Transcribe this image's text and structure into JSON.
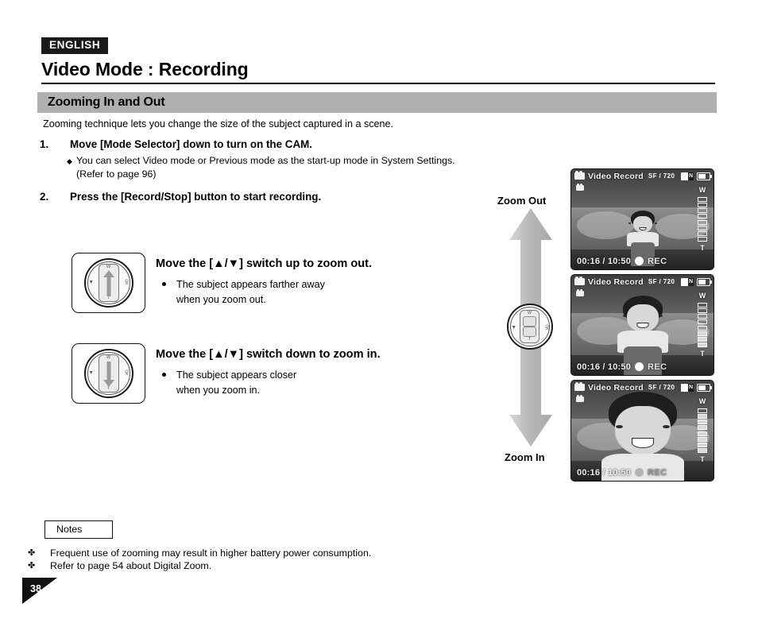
{
  "header": {
    "language_badge": "ENGLISH",
    "title": "Video Mode : Recording"
  },
  "section": {
    "title": "Zooming In and Out",
    "intro": "Zooming technique lets you change the size of the subject captured in a scene."
  },
  "steps": [
    {
      "number": "1.",
      "text": "Move [Mode Selector] down to turn on the CAM.",
      "sub_bullets": [
        {
          "marker": "◆",
          "line1": "You can select Video mode or Previous mode as the start-up mode in System Settings.",
          "line2": "(Refer to page 96)"
        }
      ]
    },
    {
      "number": "2.",
      "text": "Press the [Record/Stop] button to start recording."
    }
  ],
  "zoom_actions": [
    {
      "heading": "Move the [▲/▼] switch up to zoom out.",
      "desc_line1": "The subject appears farther away",
      "desc_line2": "when you zoom out.",
      "dial_direction": "up",
      "dial_top_label": "W",
      "dial_bottom_label": "T",
      "dial_left_label": "◀",
      "dial_right_label": "OK"
    },
    {
      "heading": "Move the [▲/▼] switch down to zoom in.",
      "desc_line1": "The subject appears closer",
      "desc_line2": "when you zoom in.",
      "dial_direction": "down",
      "dial_top_label": "W",
      "dial_bottom_label": "T",
      "dial_left_label": "◀",
      "dial_right_label": "OK"
    }
  ],
  "arrow_column": {
    "top_label": "Zoom Out",
    "bottom_label": "Zoom In",
    "arrow_color": "#bfbfbf",
    "center_dial": {
      "top_label": "W",
      "bottom_label": "T",
      "left_label": "◀",
      "right_label": "OK"
    }
  },
  "lcd_panels": [
    {
      "mode_text": "Video Record",
      "quality": "SF  /  720",
      "card_badge": "N",
      "timecode": "00:16 / 10:50",
      "rec_label": "REC",
      "rec_active": true,
      "zoom_top_label": "W",
      "zoom_bottom_label": "T",
      "zoom_segments": 8,
      "zoom_filled": 0,
      "subject_scale": "wide"
    },
    {
      "mode_text": "Video Record",
      "quality": "SF  /  720",
      "card_badge": "N",
      "timecode": "00:16 / 10:50",
      "rec_label": "REC",
      "rec_active": true,
      "zoom_top_label": "W",
      "zoom_bottom_label": "T",
      "zoom_segments": 8,
      "zoom_filled": 3,
      "subject_scale": "medium"
    },
    {
      "mode_text": "Video Record",
      "quality": "SF  /  720",
      "card_badge": "N",
      "timecode": "00:16 / 10:50",
      "rec_label": "REC",
      "rec_active": false,
      "zoom_top_label": "W",
      "zoom_bottom_label": "T",
      "zoom_segments": 8,
      "zoom_filled": 7,
      "subject_scale": "close"
    }
  ],
  "notes": {
    "label": "Notes",
    "items": [
      {
        "marker": "✤",
        "text": "Frequent use of zooming may result in higher battery power consumption."
      },
      {
        "marker": "✤",
        "text": "Refer to page 54 about Digital Zoom."
      }
    ]
  },
  "footer": {
    "page_number": "38"
  }
}
